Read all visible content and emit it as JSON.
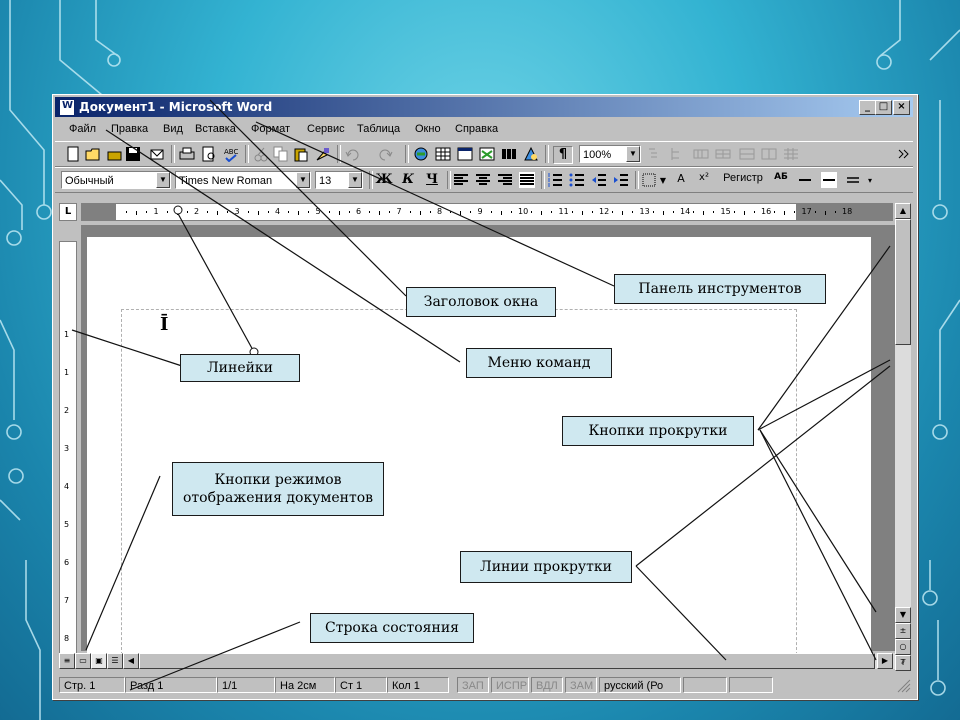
{
  "window": {
    "title": "Документ1 - Microsoft Word",
    "min_label": "_",
    "max_label": "□",
    "close_label": "×"
  },
  "menu": [
    "Файл",
    "Правка",
    "Вид",
    "Вставка",
    "Формат",
    "Сервис",
    "Таблица",
    "Окно",
    "Справка"
  ],
  "toolbar": {
    "zoom": "100%",
    "paragraph_mark": "¶"
  },
  "format_bar": {
    "style": "Обычный",
    "font": "Times New Roman",
    "size": "13",
    "bold": "Ж",
    "italic": "К",
    "underline": "Ч",
    "register": "Регистр",
    "ab": "АБ",
    "superscript": "x²",
    "font_color": "A"
  },
  "ruler": {
    "numbers": [
      "1",
      "2",
      "3",
      "4",
      "5",
      "6",
      "7",
      "8",
      "9",
      "10",
      "11",
      "12",
      "13",
      "14",
      "15",
      "16",
      "17",
      "18"
    ],
    "vnumbers": [
      "1",
      "1",
      "2",
      "3",
      "4",
      "5",
      "6",
      "7",
      "8"
    ]
  },
  "status": {
    "page": "Стр. 1",
    "section": "Разд 1",
    "pages": "1/1",
    "at": "На 2см",
    "line": "Ст 1",
    "col": "Кол 1",
    "rec": "ЗАП",
    "trk": "ИСПР",
    "ext": "ВДЛ",
    "ovr": "ЗАМ",
    "lang": "русский (Ро"
  },
  "callouts": {
    "title": "Заголовок окна",
    "toolbar": "Панель инструментов",
    "menu": "Меню команд",
    "rulers": "Линейки",
    "scroll_buttons": "Кнопки прокрутки",
    "view_modes": "Кнопки режимов отображения документов",
    "scroll_lines": "Линии прокрутки",
    "status_bar": "Строка состояния"
  },
  "colors": {
    "titlebar_start": "#0a246a",
    "titlebar_end": "#a6caf0",
    "callout_bg": "#cfe8f0",
    "chrome": "#c0c0c0"
  }
}
